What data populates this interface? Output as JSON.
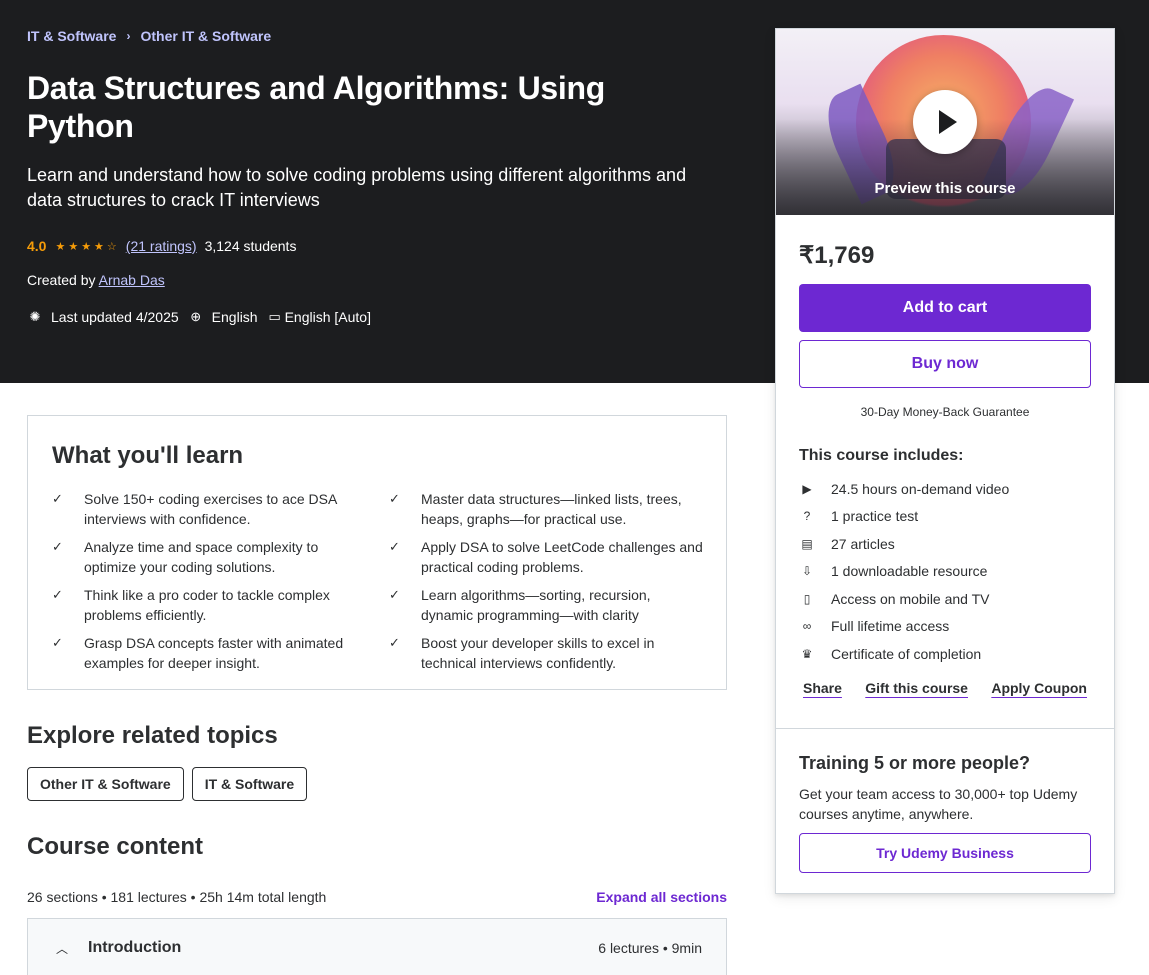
{
  "breadcrumb": [
    "IT & Software",
    "Other IT & Software"
  ],
  "course": {
    "title": "Data Structures and Algorithms: Using Python",
    "subtitle": "Learn and understand how to solve coding problems using different algorithms and data structures to crack IT interviews",
    "rating": "4.0",
    "stars": "★★★★☆",
    "ratings_link": "(21 ratings)",
    "students": "3,124 students",
    "created_by_label": "Created by",
    "instructor": "Arnab Das",
    "last_updated": "Last updated 4/2025",
    "language": "English",
    "captions": "English [Auto]"
  },
  "sidebar": {
    "preview_label": "Preview this course",
    "price": "₹1,769",
    "add_to_cart": "Add to cart",
    "buy_now": "Buy now",
    "guarantee": "30-Day Money-Back Guarantee",
    "includes_title": "This course includes:",
    "includes": [
      {
        "icon": "video-icon",
        "label": "24.5 hours on-demand video"
      },
      {
        "icon": "practice-test-icon",
        "label": "1 practice test"
      },
      {
        "icon": "article-icon",
        "label": "27 articles"
      },
      {
        "icon": "download-file-icon",
        "label": "1 downloadable resource"
      },
      {
        "icon": "mobile-icon",
        "label": "Access on mobile and TV"
      },
      {
        "icon": "infinity-icon",
        "label": "Full lifetime access"
      },
      {
        "icon": "trophy-icon",
        "label": "Certificate of completion"
      }
    ],
    "links": [
      "Share",
      "Gift this course",
      "Apply Coupon"
    ],
    "training_title": "Training 5 or more people?",
    "training_text": "Get your team access to 30,000+ top Udemy courses anytime, anywhere.",
    "business_button": "Try Udemy Business"
  },
  "learn": {
    "title": "What you'll learn",
    "items": [
      "Solve 150+ coding exercises to ace DSA interviews with confidence.",
      "Master data structures—linked lists, trees, heaps, graphs—for practical use.",
      "Analyze time and space complexity to optimize your coding solutions.",
      "Apply DSA to solve LeetCode challenges and practical coding problems.",
      "Think like a pro coder to tackle complex problems efficiently.",
      "Learn algorithms—sorting, recursion, dynamic programming—with clarity",
      "Grasp DSA concepts faster with animated examples for deeper insight.",
      "Boost your developer skills to excel in technical interviews confidently."
    ]
  },
  "explore": {
    "title": "Explore related topics",
    "topics": [
      "Other IT & Software",
      "IT & Software"
    ]
  },
  "content": {
    "title": "Course content",
    "summary": "26 sections • 181 lectures • 25h 14m total length",
    "expand_all": "Expand all sections",
    "sections": [
      {
        "name": "Introduction",
        "info": "6 lectures • 9min"
      }
    ]
  },
  "colors": {
    "hero_bg": "#1c1d1f",
    "accent": "#6d28d2",
    "link_light": "#c0c4fc",
    "star": "#f69c08"
  }
}
